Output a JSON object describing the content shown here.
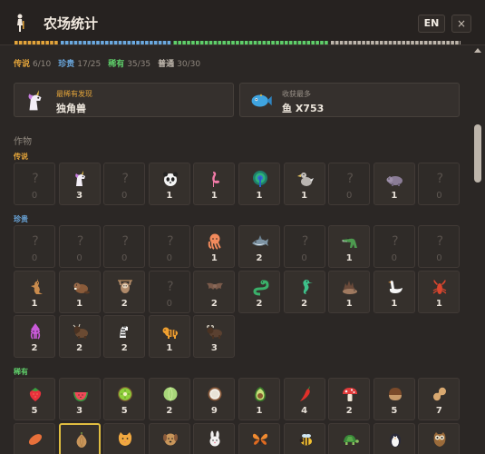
{
  "window": {
    "title": "农场统计",
    "lang": "EN",
    "close": "×"
  },
  "colors": {
    "legendary": "#e3a43a",
    "rare": "#6ba9e0",
    "uncommon": "#5fcf6a",
    "common": "#bdb5ab"
  },
  "stats": [
    {
      "name": "传说",
      "count": "6/10",
      "rarity": "legendary"
    },
    {
      "name": "珍贵",
      "count": "17/25",
      "rarity": "rare"
    },
    {
      "name": "稀有",
      "count": "35/35",
      "rarity": "uncommon"
    },
    {
      "name": "普通",
      "count": "30/30",
      "rarity": "common"
    }
  ],
  "highlights": [
    {
      "label": "最稀有发现",
      "value": "独角兽",
      "icon": "unicorn-icon",
      "label_rarity": "legendary"
    },
    {
      "label": "收获最多",
      "value": "鱼 X753",
      "icon": "fish-icon",
      "label_rarity": "common"
    }
  ],
  "section": "作物",
  "rarity_labels": {
    "legendary": "传说",
    "rare": "珍贵",
    "uncommon": "稀有"
  },
  "legendary_items": [
    {
      "icon": "locked-icon",
      "count": "0",
      "locked": true
    },
    {
      "icon": "unicorn-icon",
      "count": "3"
    },
    {
      "icon": "locked-icon",
      "count": "0",
      "locked": true
    },
    {
      "icon": "panda-icon",
      "count": "1"
    },
    {
      "icon": "flamingo-icon",
      "count": "1"
    },
    {
      "icon": "peacock-icon",
      "count": "1"
    },
    {
      "icon": "dodo-icon",
      "count": "1"
    },
    {
      "icon": "locked-icon",
      "count": "0",
      "locked": true
    },
    {
      "icon": "hippo-icon",
      "count": "1"
    },
    {
      "icon": "locked-icon",
      "count": "0",
      "locked": true
    }
  ],
  "rare_items": [
    {
      "icon": "locked-icon",
      "count": "0",
      "locked": true
    },
    {
      "icon": "locked-icon",
      "count": "0",
      "locked": true
    },
    {
      "icon": "locked-icon",
      "count": "0",
      "locked": true
    },
    {
      "icon": "locked-icon",
      "count": "0",
      "locked": true
    },
    {
      "icon": "octopus-icon",
      "count": "1"
    },
    {
      "icon": "shark-icon",
      "count": "2"
    },
    {
      "icon": "locked-icon",
      "count": "0",
      "locked": true
    },
    {
      "icon": "crocodile-icon",
      "count": "1"
    },
    {
      "icon": "locked-icon",
      "count": "0",
      "locked": true
    },
    {
      "icon": "locked-icon",
      "count": "0",
      "locked": true
    },
    {
      "icon": "kangaroo-icon",
      "count": "1"
    },
    {
      "icon": "beaver-icon",
      "count": "1"
    },
    {
      "icon": "sloth-icon",
      "count": "2"
    },
    {
      "icon": "locked-icon",
      "count": "0",
      "locked": true
    },
    {
      "icon": "bat-icon",
      "count": "2"
    },
    {
      "icon": "snake-icon",
      "count": "2"
    },
    {
      "icon": "seahorse-icon",
      "count": "2"
    },
    {
      "icon": "hedgehog-icon",
      "count": "1"
    },
    {
      "icon": "swan-icon",
      "count": "1"
    },
    {
      "icon": "lobster-icon",
      "count": "1"
    },
    {
      "icon": "squid-icon",
      "count": "2"
    },
    {
      "icon": "bison-icon",
      "count": "2"
    },
    {
      "icon": "zebra-icon",
      "count": "2"
    },
    {
      "icon": "tiger-icon",
      "count": "1"
    },
    {
      "icon": "buffalo-icon",
      "count": "3"
    }
  ],
  "uncommon_items": [
    {
      "icon": "strawberry-icon",
      "count": "5"
    },
    {
      "icon": "watermelon-icon",
      "count": "3"
    },
    {
      "icon": "kiwi-icon",
      "count": "5"
    },
    {
      "icon": "melon-icon",
      "count": "2"
    },
    {
      "icon": "coconut-icon",
      "count": "9"
    },
    {
      "icon": "avocado-icon",
      "count": "1"
    },
    {
      "icon": "chili-icon",
      "count": "4"
    },
    {
      "icon": "mushroom-icon",
      "count": "2"
    },
    {
      "icon": "chestnut-icon",
      "count": "5"
    },
    {
      "icon": "peanut-icon",
      "count": "7"
    },
    {
      "icon": "sweet-potato-icon",
      "count": ""
    },
    {
      "icon": "onion-icon",
      "count": "",
      "selected": true
    },
    {
      "icon": "cat-icon",
      "count": ""
    },
    {
      "icon": "dog-icon",
      "count": ""
    },
    {
      "icon": "rabbit-icon",
      "count": ""
    },
    {
      "icon": "butterfly-icon",
      "count": ""
    },
    {
      "icon": "bee-icon",
      "count": ""
    },
    {
      "icon": "turtle-icon",
      "count": ""
    },
    {
      "icon": "penguin-icon",
      "count": ""
    },
    {
      "icon": "owl-icon",
      "count": ""
    }
  ]
}
